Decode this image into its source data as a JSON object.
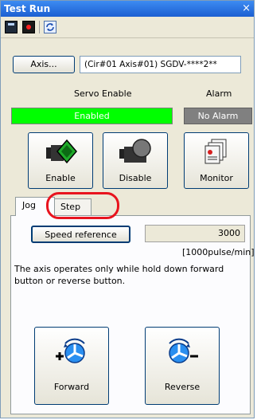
{
  "window": {
    "title": "Test Run",
    "close_glyph": "×"
  },
  "toolbar": {
    "icons": [
      "calculator-icon",
      "record-icon",
      "refresh-icon"
    ]
  },
  "axis": {
    "button_label": "Axis...",
    "value": "(Cir#01 Axis#01) SGDV-****2**"
  },
  "servo": {
    "label": "Servo Enable",
    "status": "Enabled",
    "status_color": "#00ff00"
  },
  "alarm": {
    "label": "Alarm",
    "status": "No Alarm",
    "status_color": "#808080"
  },
  "actions": {
    "enable_label": "Enable",
    "disable_label": "Disable",
    "monitor_label": "Monitor"
  },
  "tabs": {
    "jog_label": "Jog",
    "step_label": "Step",
    "active": "Jog"
  },
  "jog": {
    "speed_button_label": "Speed reference",
    "speed_value": "3000",
    "speed_unit": "[1000pulse/min]",
    "description": "The axis operates only while hold down forward button or reverse button.",
    "forward_label": "Forward",
    "reverse_label": "Reverse"
  },
  "annotation": {
    "highlight_color": "#e8141e",
    "target": "Step"
  }
}
